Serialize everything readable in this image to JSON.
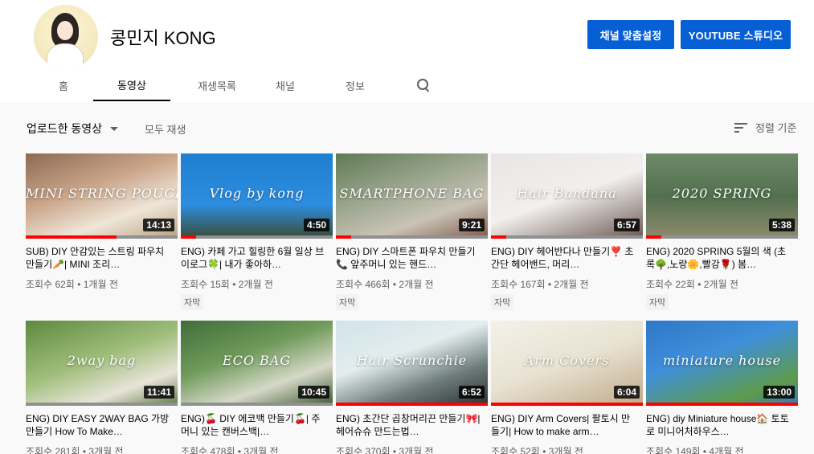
{
  "channel": {
    "name": "콩민지 KONG",
    "customize_button": "채널 맞춤설정",
    "studio_button": "YOUTUBE 스튜디오"
  },
  "tabs": [
    {
      "label": "홈",
      "active": false
    },
    {
      "label": "동영상",
      "active": true
    },
    {
      "label": "재생목록",
      "active": false
    },
    {
      "label": "채널",
      "active": false
    },
    {
      "label": "정보",
      "active": false
    }
  ],
  "toolbar": {
    "uploads_label": "업로드한 동영상",
    "play_all": "모두 재생",
    "sort_label": "정렬 기준"
  },
  "colors": {
    "accent": "#065fd4",
    "progress": "#ff0000"
  },
  "videos": [
    {
      "thumb_text": "MINI STRING POUCH",
      "duration": "14:13",
      "watched": 0.6,
      "title": "SUB) DIY 안감있는 스트링 파우치 만들기🥕| MINI 조리…",
      "views": "조회수 62회",
      "age": "1개월 전",
      "badge": ""
    },
    {
      "thumb_text": "Vlog by kong",
      "duration": "4:50",
      "watched": 0.1,
      "title": "ENG) 카페 가고 힐링한 6월 일상 브이로그🍀| 내가 좋아하…",
      "views": "조회수 15회",
      "age": "2개월 전",
      "badge": "자막"
    },
    {
      "thumb_text": "SMARTPHONE BAG",
      "duration": "9:21",
      "watched": 0.1,
      "title": "ENG) DIY 스마트폰 파우치 만들기📞 앞주머니 있는 핸드…",
      "views": "조회수 466회",
      "age": "2개월 전",
      "badge": "자막"
    },
    {
      "thumb_text": "Hair Bandana",
      "duration": "6:57",
      "watched": 0.1,
      "title": "ENG) DIY 헤어반다나 만들기❣️ 초간단 헤어밴드, 머리…",
      "views": "조회수 167회",
      "age": "2개월 전",
      "badge": "자막"
    },
    {
      "thumb_text": "2020 SPRING",
      "duration": "5:38",
      "watched": 0.1,
      "title": "ENG) 2020 SPRING 5월의 색 (초록🌳,노랑🌼,빨강🌹) 봄…",
      "views": "조회수 22회",
      "age": "2개월 전",
      "badge": "자막"
    },
    {
      "thumb_text": "2way bag",
      "duration": "11:41",
      "watched": 0.0,
      "title": "ENG) DIY EASY 2WAY BAG 가방만들기 How To Make…",
      "views": "조회수 281회",
      "age": "3개월 전",
      "badge": ""
    },
    {
      "thumb_text": "ECO BAG",
      "duration": "10:45",
      "watched": 0.0,
      "title": "ENG)🍒 DIY 에코백 만들기🍒| 주머니 있는 캔버스백|…",
      "views": "조회수 478회",
      "age": "3개월 전",
      "badge": ""
    },
    {
      "thumb_text": "Hair Scrunchie",
      "duration": "6:52",
      "watched": 1.0,
      "title": "ENG) 초간단 곱창머리끈 만들기🎀| 헤어슈슈 만드는법…",
      "views": "조회수 370회",
      "age": "3개월 전",
      "badge": ""
    },
    {
      "thumb_text": "Arm Covers",
      "duration": "6:04",
      "watched": 1.0,
      "title": "ENG) DIY Arm Covers| 팔토시 만들기| How to make arm…",
      "views": "조회수 52회",
      "age": "3개월 전",
      "badge": ""
    },
    {
      "thumb_text": "miniature house",
      "duration": "13:00",
      "watched": 1.0,
      "title": "ENG) diy Miniature house🏠 토토로 미니어처하우스…",
      "views": "조회수 149회",
      "age": "4개월 전",
      "badge": ""
    }
  ]
}
